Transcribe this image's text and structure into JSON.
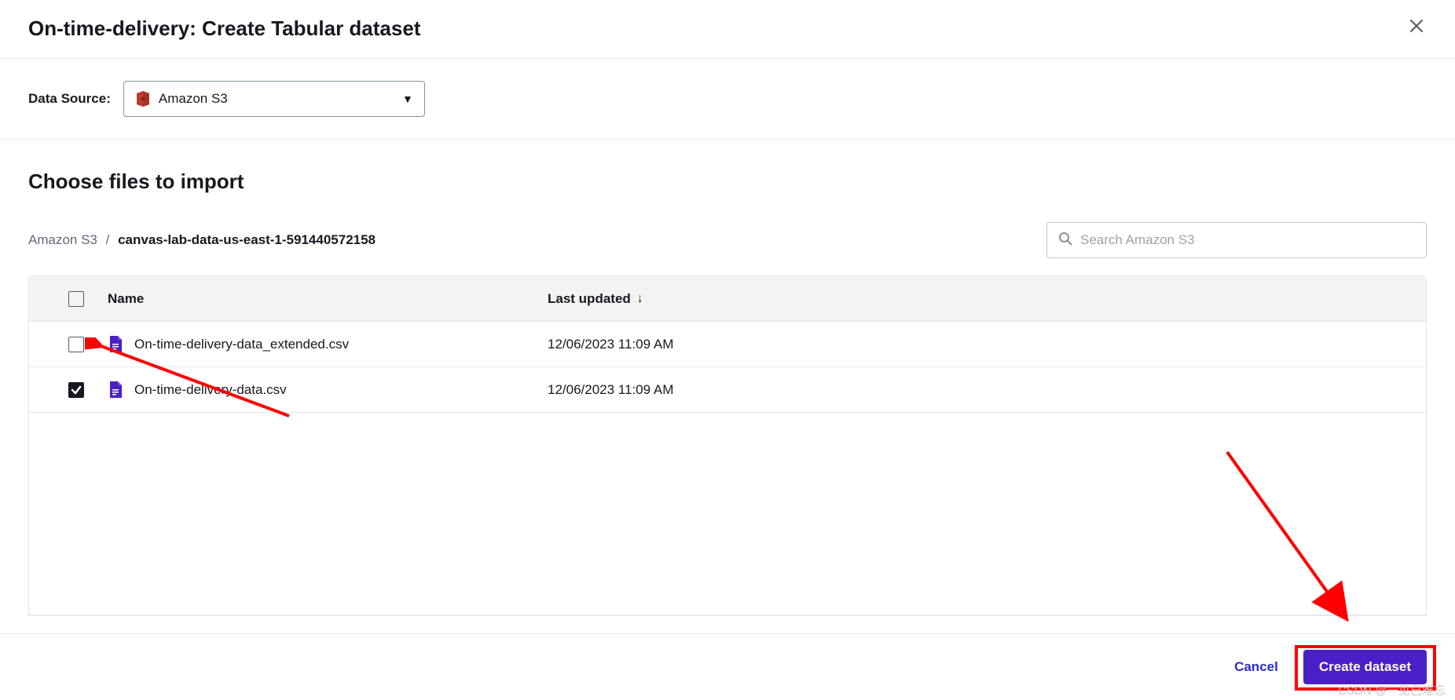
{
  "header": {
    "title": "On-time-delivery: Create Tabular dataset"
  },
  "dataSource": {
    "label": "Data Source:",
    "selected": "Amazon S3"
  },
  "section": {
    "title": "Choose files to import"
  },
  "breadcrumb": {
    "root": "Amazon S3",
    "current": "canvas-lab-data-us-east-1-591440572158"
  },
  "search": {
    "placeholder": "Search Amazon S3"
  },
  "table": {
    "headers": {
      "name": "Name",
      "lastUpdated": "Last updated"
    },
    "rows": [
      {
        "checked": false,
        "name": "On-time-delivery-data_extended.csv",
        "lastUpdated": "12/06/2023 11:09 AM"
      },
      {
        "checked": true,
        "name": "On-time-delivery-data.csv",
        "lastUpdated": "12/06/2023 11:09 AM"
      }
    ]
  },
  "footer": {
    "cancel": "Cancel",
    "create": "Create dataset"
  },
  "watermark": "CSDN @一见已难忘"
}
